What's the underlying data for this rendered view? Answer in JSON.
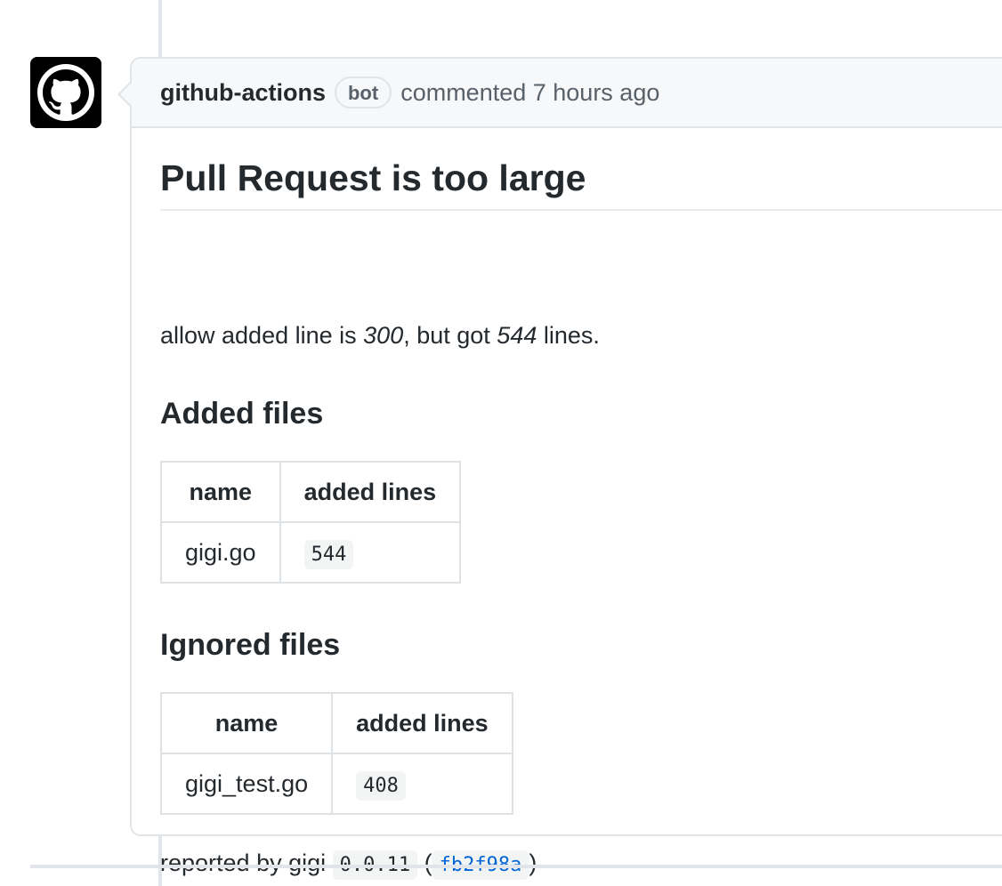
{
  "comment": {
    "author": "github-actions",
    "badge": "bot",
    "action": "commented 7 hours ago"
  },
  "body": {
    "title": "Pull Request is too large",
    "summary": {
      "prefix": "allow added line is ",
      "allowed": "300",
      "middle": ", but got ",
      "actual": "544",
      "suffix": " lines."
    },
    "added_heading": "Added files",
    "added_table": {
      "headers": [
        "name",
        "added lines"
      ],
      "rows": [
        [
          "gigi.go",
          "544"
        ]
      ]
    },
    "ignored_heading": "Ignored files",
    "ignored_table": {
      "headers": [
        "name",
        "added lines"
      ],
      "rows": [
        [
          "gigi_test.go",
          "408"
        ]
      ]
    },
    "footer": {
      "prefix": "reported by gigi ",
      "version": "0.0.11",
      "open_paren": "(",
      "sha": "fb2f98a",
      "close_paren": ")"
    }
  },
  "icons": {
    "avatar": "github-octocat-icon"
  }
}
